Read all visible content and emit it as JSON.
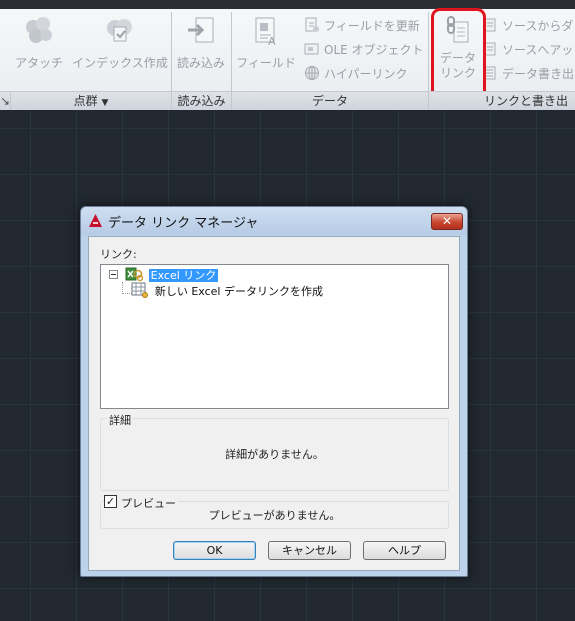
{
  "ribbon": {
    "buttons": {
      "attach": "アタッチ",
      "create_index": "インデックス作成",
      "import": "読み込み",
      "field": "フィールド",
      "update_fields": "フィールドを更新",
      "ole_object": "OLE オブジェクト",
      "hyperlink": "ハイパーリンク",
      "data_link_line1": "データ",
      "data_link_line2": "リンク",
      "source_download": "ソースからダ",
      "source_upload": "ソースへアッ",
      "data_write": "データ書き出"
    },
    "panels": {
      "point_cloud": "点群",
      "point_cloud_dropdown": "▼",
      "import": "読み込み",
      "data": "データ",
      "link_and_write": "リンクと書き出"
    },
    "collapsed_arrow": "↘"
  },
  "dialog": {
    "title": "データ リンク マネージャ",
    "close_glyph": "✕",
    "links_label": "リンク:",
    "tree": {
      "root_label": "Excel リンク",
      "child_label": "新しい Excel データリンクを作成"
    },
    "details": {
      "title": "詳細",
      "text": "詳細がありません。"
    },
    "preview": {
      "title": "プレビュー",
      "checked": true,
      "check_glyph": "✓",
      "text": "プレビューがありません。"
    },
    "buttons": {
      "ok": "OK",
      "cancel": "キャンセル",
      "help": "ヘルプ"
    }
  },
  "colors": {
    "highlight_ring": "#e0141e",
    "selection": "#3399ff",
    "drawing_background": "#212830"
  }
}
